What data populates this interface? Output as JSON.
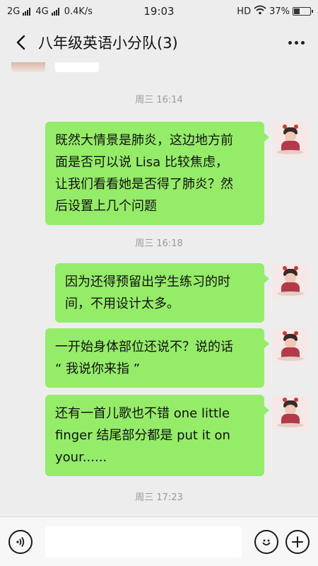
{
  "status_bar": {
    "left": "2G ",
    "network2": "4G ",
    "speed": "0.4K/s",
    "time": "19:03",
    "hd": "HD",
    "battery": "37%",
    "battery_level": 0.37
  },
  "header": {
    "title": "八年级英语小分队(3)",
    "back_icon": "chevron-left-icon",
    "more_icon": "more-dots-icon"
  },
  "messages": [
    {
      "type": "time",
      "text": "周三 16:14"
    },
    {
      "type": "sent",
      "lines": [
        "既然大情景是肺炎，这边地方前",
        "面是否可以说 Lisa 比较焦虑，",
        "让我们看看她是否得了肺炎？然",
        "后设置上几个问题"
      ]
    },
    {
      "type": "time",
      "text": "周三 16:18"
    },
    {
      "type": "sent",
      "lines": [
        "因为还得预留出学生练习的时",
        "间，不用设计太多。"
      ]
    },
    {
      "type": "sent",
      "lines": [
        "一开始身体部位还说不？说的话",
        "“ 我说你来指 ”"
      ]
    },
    {
      "type": "sent",
      "lines": [
        "还有一首儿歌也不错  one little",
        "finger  结尾部分都是 put it on",
        "your......"
      ]
    },
    {
      "type": "time",
      "text": "周三 17:23"
    }
  ],
  "input_bar": {
    "voice_icon": "voice-icon",
    "emoji_icon": "emoji-icon",
    "plus_icon": "plus-icon",
    "placeholder": ""
  },
  "colors": {
    "background": "#ededed",
    "sent_bubble": "#95ec69",
    "time_text": "#9a9a9a"
  }
}
